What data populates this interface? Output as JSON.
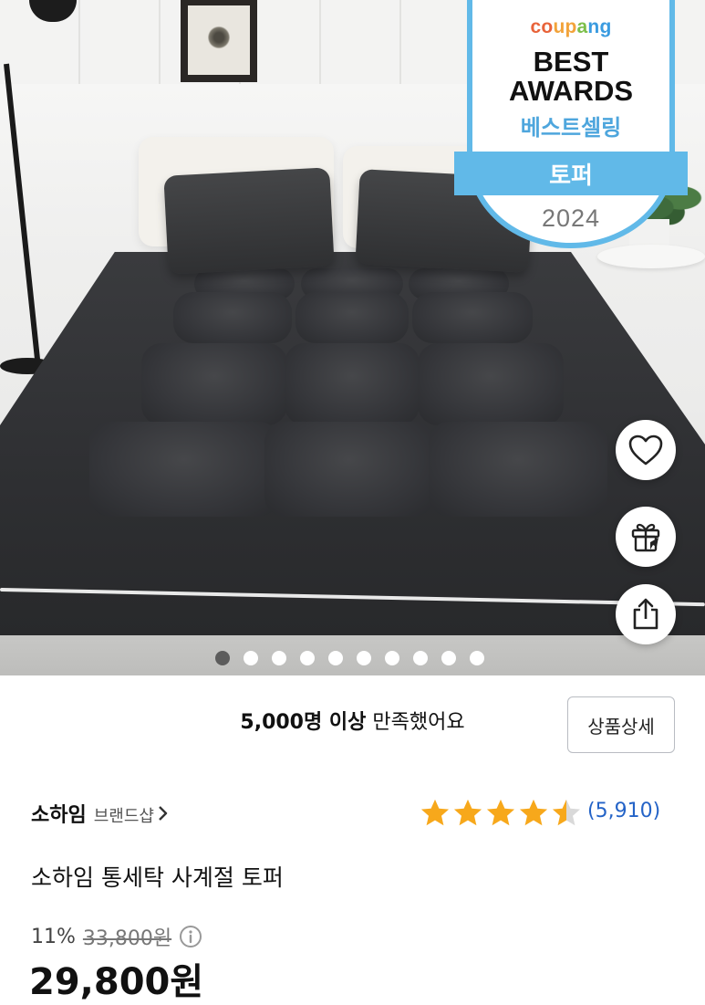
{
  "award": {
    "brand": "coupang",
    "brand_letters": [
      {
        "ch": "c",
        "color": "#e8633a"
      },
      {
        "ch": "o",
        "color": "#e8633a"
      },
      {
        "ch": "u",
        "color": "#f2a33a"
      },
      {
        "ch": "p",
        "color": "#f2a33a"
      },
      {
        "ch": "a",
        "color": "#7cbf4a"
      },
      {
        "ch": "n",
        "color": "#3a9be0"
      },
      {
        "ch": "g",
        "color": "#3a9be0"
      }
    ],
    "line1": "BEST",
    "line2": "AWARDS",
    "korean": "베스트셀링",
    "category": "토퍼",
    "year": "2024",
    "accent_color": "#61b9e8"
  },
  "actions": [
    {
      "name": "wishlist-button",
      "icon": "heart-icon"
    },
    {
      "name": "gift-button",
      "icon": "gift-icon"
    },
    {
      "name": "share-button",
      "icon": "share-icon"
    }
  ],
  "carousel": {
    "total": 10,
    "active_index": 0
  },
  "satisfaction": {
    "bold": "5,000명 이상",
    "rest": " 만족했어요"
  },
  "detail_button": "상품상세",
  "brand": {
    "name": "소하임",
    "shop_link": "브랜드샵"
  },
  "rating": {
    "stars": 4.5,
    "max": 5,
    "count": "(5,910)",
    "star_color": "#f7a81b"
  },
  "product_title": "소하임 통세탁 사계절 토퍼",
  "discount": {
    "rate": "11%",
    "original_price": "33,800원"
  },
  "price": "29,800원",
  "colors": {
    "link_blue": "#2463c7"
  }
}
